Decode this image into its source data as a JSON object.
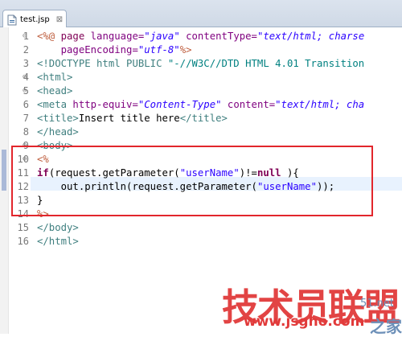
{
  "tab": {
    "label": "test.jsp",
    "close": "⊠"
  },
  "lines": [
    {
      "n": "1",
      "fold": "⊖",
      "parts": [
        [
          "d",
          "<%@ "
        ],
        [
          "k2",
          "page "
        ],
        [
          "a",
          "language="
        ],
        [
          "s",
          "\"java\""
        ],
        [
          "p",
          " "
        ],
        [
          "a",
          "contentType="
        ],
        [
          "s",
          "\"text/html; charse"
        ]
      ]
    },
    {
      "n": "2",
      "fold": "",
      "parts": [
        [
          "p",
          "    "
        ],
        [
          "a",
          "pageEncoding="
        ],
        [
          "s",
          "\"utf-8\""
        ],
        [
          "d",
          "%>"
        ]
      ]
    },
    {
      "n": "3",
      "fold": "",
      "parts": [
        [
          "t",
          "<!DOCTYPE html PUBLIC "
        ],
        [
          "dt",
          "\"-//W3C//DTD HTML 4.01 Transition"
        ]
      ]
    },
    {
      "n": "4",
      "fold": "⊖",
      "parts": [
        [
          "t",
          "<html>"
        ]
      ]
    },
    {
      "n": "5",
      "fold": "⊖",
      "parts": [
        [
          "t",
          "<head>"
        ]
      ]
    },
    {
      "n": "6",
      "fold": "",
      "parts": [
        [
          "t",
          "<meta "
        ],
        [
          "a",
          "http-equiv="
        ],
        [
          "s",
          "\"Content-Type\""
        ],
        [
          "p",
          " "
        ],
        [
          "a",
          "content="
        ],
        [
          "s",
          "\"text/html; cha"
        ]
      ]
    },
    {
      "n": "7",
      "fold": "",
      "parts": [
        [
          "t",
          "<title>"
        ],
        [
          "p",
          "Insert title here"
        ],
        [
          "t",
          "</title>"
        ]
      ]
    },
    {
      "n": "8",
      "fold": "",
      "parts": [
        [
          "t",
          "</head>"
        ]
      ]
    },
    {
      "n": "9",
      "fold": "⊖",
      "parts": [
        [
          "t",
          "<body>"
        ]
      ]
    },
    {
      "n": "10",
      "fold": "⊖",
      "parts": [
        [
          "d",
          "<%"
        ]
      ]
    },
    {
      "n": "11",
      "fold": "",
      "parts": [
        [
          "k",
          "if"
        ],
        [
          "p",
          "(request.getParameter("
        ],
        [
          "q",
          "\"userName\""
        ],
        [
          "p",
          ")!="
        ],
        [
          "k",
          "null"
        ],
        [
          "p",
          " ){"
        ]
      ]
    },
    {
      "n": "12",
      "fold": "",
      "parts": [
        [
          "p",
          "    out.println(request.getParameter("
        ],
        [
          "q",
          "\"userName\""
        ],
        [
          "p",
          "));"
        ]
      ]
    },
    {
      "n": "13",
      "fold": "",
      "parts": [
        [
          "p",
          "}"
        ]
      ]
    },
    {
      "n": "14",
      "fold": "",
      "parts": [
        [
          "d",
          "%>"
        ]
      ]
    },
    {
      "n": "15",
      "fold": "",
      "parts": [
        [
          "t",
          "</body>"
        ]
      ]
    },
    {
      "n": "16",
      "fold": "",
      "parts": [
        [
          "t",
          "</html>"
        ]
      ]
    }
  ],
  "watermark": {
    "main": "技术员联盟",
    "url": "www.jsgho.com",
    "side_top": "51.net",
    "side_bottom": "之家"
  },
  "colors": {
    "keyword": "#7f0055",
    "directive": "#bf5f3f",
    "tag": "#3f7f7f",
    "attribute": "#7f007f",
    "string": "#2a00ff",
    "highlight": "#e2262c"
  }
}
